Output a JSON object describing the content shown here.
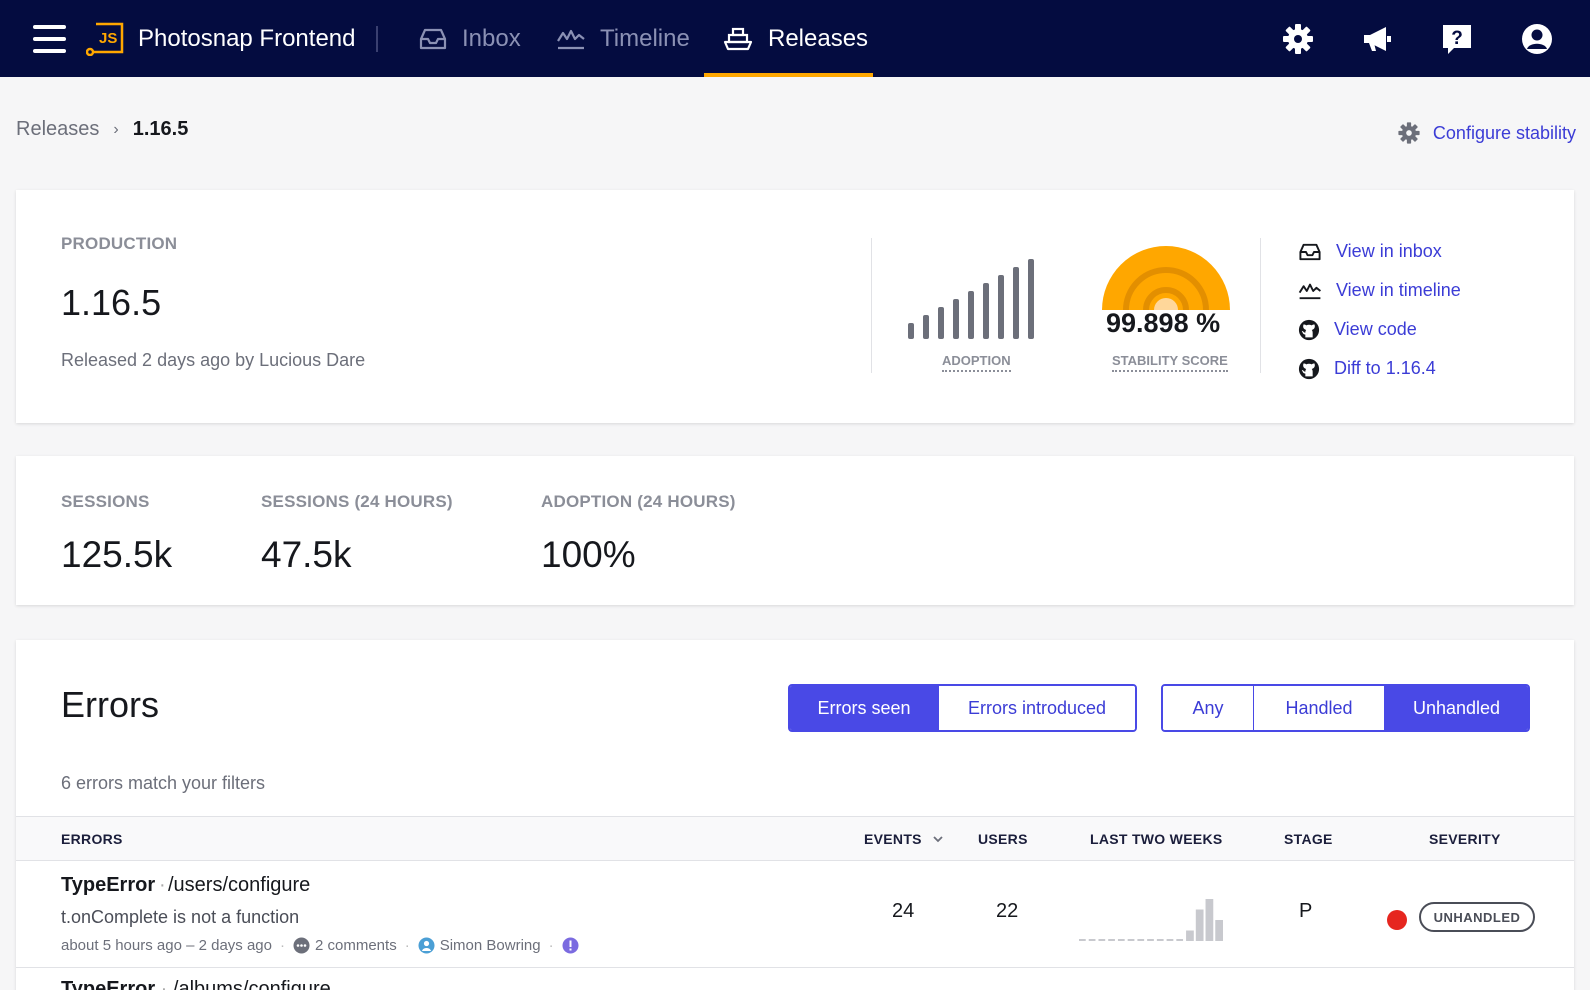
{
  "app": {
    "logo_text": "JS",
    "project_name": "Photosnap Frontend"
  },
  "nav": {
    "items": [
      {
        "label": "Inbox",
        "icon": "inbox-icon",
        "active": false
      },
      {
        "label": "Timeline",
        "icon": "timeline-icon",
        "active": false
      },
      {
        "label": "Releases",
        "icon": "ship-icon",
        "active": true
      }
    ],
    "right_icons": [
      "gear-icon",
      "megaphone-icon",
      "help-icon",
      "user-icon"
    ],
    "accent_color": "#ffa700",
    "background_color": "#040c40"
  },
  "breadcrumb": {
    "parent": "Releases",
    "separator": "›",
    "current": "1.16.5"
  },
  "configure_stability": "Configure stability",
  "release": {
    "stage": "PRODUCTION",
    "version": "1.16.5",
    "released_text": "Released 2 days ago by Lucious Dare",
    "adoption_label": "ADOPTION",
    "adoption_bars": [
      2,
      3,
      4,
      5,
      6,
      7,
      8,
      9,
      10
    ],
    "stability_label": "STABILITY SCORE",
    "stability_value": "99.898 %",
    "stability_color": "#ffa700",
    "links": [
      {
        "label": "View in inbox",
        "icon": "inbox-icon"
      },
      {
        "label": "View in timeline",
        "icon": "timeline-icon"
      },
      {
        "label": "View code",
        "icon": "github-icon"
      },
      {
        "label": "Diff to 1.16.4",
        "icon": "github-icon"
      }
    ]
  },
  "stats": [
    {
      "label": "SESSIONS",
      "value": "125.5k"
    },
    {
      "label": "SESSIONS (24 HOURS)",
      "value": "47.5k"
    },
    {
      "label": "ADOPTION (24 HOURS)",
      "value": "100%"
    }
  ],
  "errors": {
    "title": "Errors",
    "filter_mode": [
      {
        "label": "Errors seen",
        "selected": true
      },
      {
        "label": "Errors introduced",
        "selected": false
      }
    ],
    "filter_handled": [
      {
        "label": "Any",
        "selected": false
      },
      {
        "label": "Handled",
        "selected": false
      },
      {
        "label": "Unhandled",
        "selected": true
      }
    ],
    "match_text": "6 errors match your filters",
    "columns": [
      "ERRORS",
      "EVENTS",
      "USERS",
      "LAST TWO WEEKS",
      "STAGE",
      "SEVERITY"
    ],
    "rows": [
      {
        "type": "TypeError",
        "path": "/users/configure",
        "message": "t.onComplete is not a function",
        "time": "about 5 hours ago – 2 days ago",
        "comments": "2 comments",
        "assignee": "Simon Bowring",
        "events": "24",
        "users": "22",
        "stage": "P",
        "severity": "UNHANDLED",
        "severity_color": "#e6261f",
        "sparkline": [
          0,
          0,
          0,
          0,
          0,
          0,
          0,
          0,
          0,
          0,
          0,
          1,
          3,
          4,
          2
        ]
      },
      {
        "type": "TypeError",
        "path": "/albums/configure"
      }
    ]
  }
}
